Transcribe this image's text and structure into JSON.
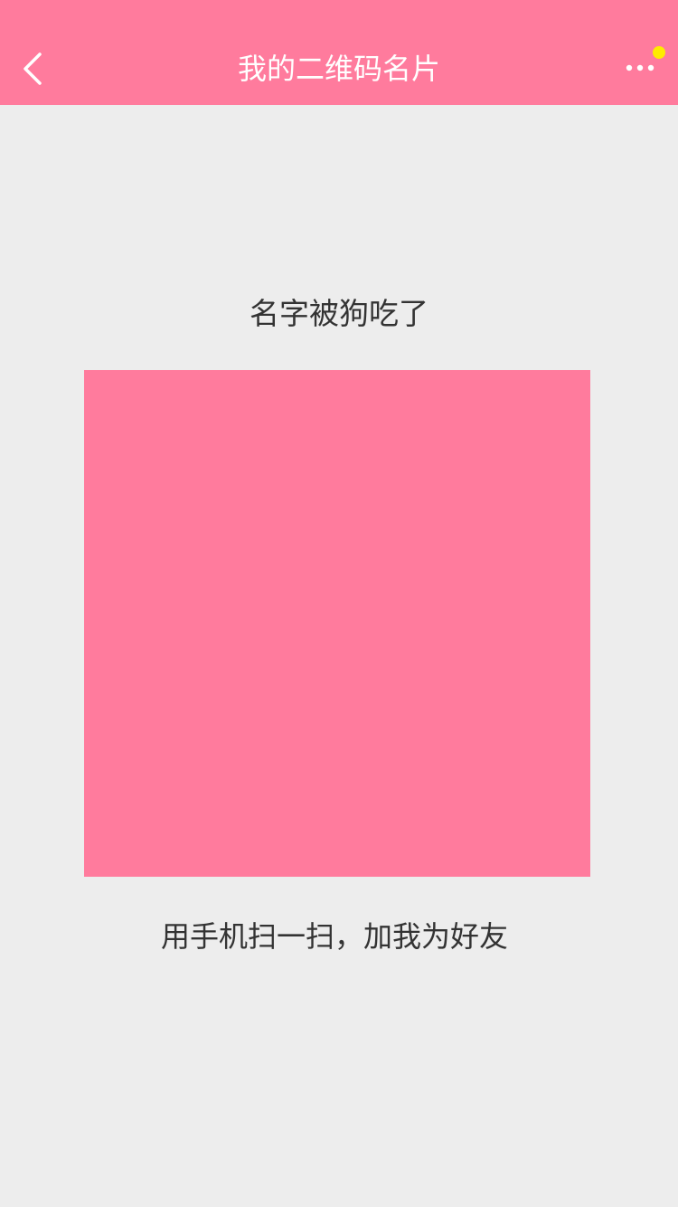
{
  "header": {
    "title": "我的二维码名片",
    "back_icon": "chevron-left-icon",
    "more_icon": "more-horizontal-icon",
    "background_color": "#ff7b9d",
    "notification_dot_color": "#ffeb00"
  },
  "profile": {
    "name": "名字被狗吃了"
  },
  "qr": {
    "color": "#ff7b9d"
  },
  "footer": {
    "hint": "用手机扫一扫，加我为好友"
  },
  "page": {
    "background_color": "#ededed"
  }
}
